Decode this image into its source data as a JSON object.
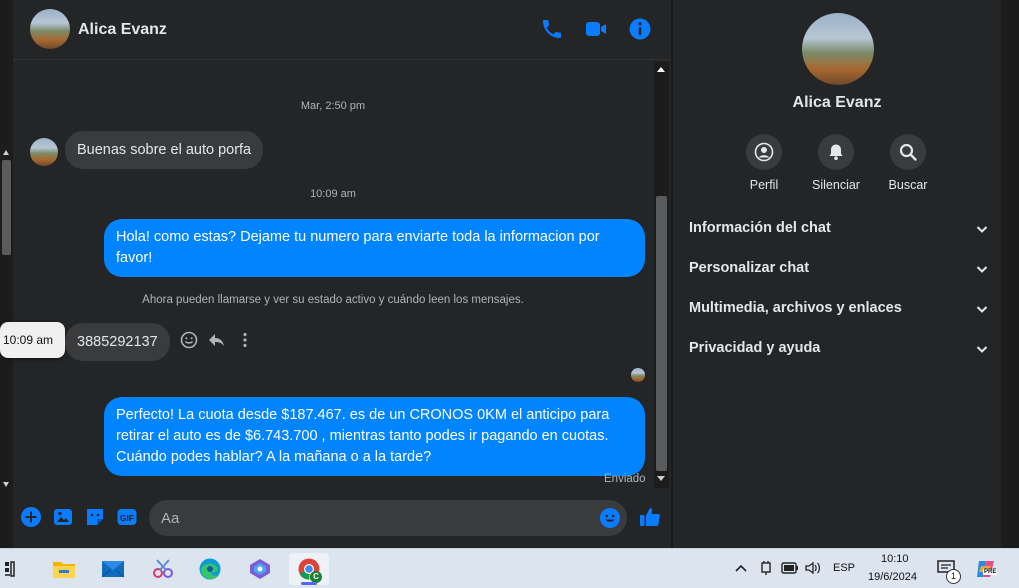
{
  "header": {
    "name": "Alica Evanz"
  },
  "messages": {
    "ts1": "Mar, 2:50 pm",
    "in1": "Buenas sobre el auto porfa",
    "ts2": "10:09 am",
    "out1": "Hola! como estas? Dejame tu numero para enviarte toda la informacion por favor!",
    "system": "Ahora pueden llamarse y ver su estado activo y cuándo leen los mensajes.",
    "tooltip": "10:09 am",
    "in2": "3885292137",
    "out2": "Perfecto! La cuota desde $187.467. es de un CRONOS 0KM el anticipo para retirar el auto es de $6.743.700 , mientras tanto podes ir pagando en cuotas. Cuándo podes hablar? A la mañana o a la tarde?",
    "status": "Enviado"
  },
  "composer": {
    "placeholder": "Aa"
  },
  "info": {
    "name": "Alica Evanz",
    "actions": [
      {
        "label": "Perfil"
      },
      {
        "label": "Silenciar"
      },
      {
        "label": "Buscar"
      }
    ],
    "sections": [
      {
        "label": "Información del chat"
      },
      {
        "label": "Personalizar chat"
      },
      {
        "label": "Multimedia, archivos y enlaces"
      },
      {
        "label": "Privacidad y ayuda"
      }
    ]
  },
  "taskbar": {
    "lang": "ESP",
    "time": "10:10",
    "date": "19/6/2024",
    "notif_count": "1",
    "chrome_badge": "C",
    "copilot_badge": "PRE"
  },
  "colors": {
    "accent": "#0084ff",
    "bg": "#242526",
    "bubble_in": "#3a3b3c"
  }
}
